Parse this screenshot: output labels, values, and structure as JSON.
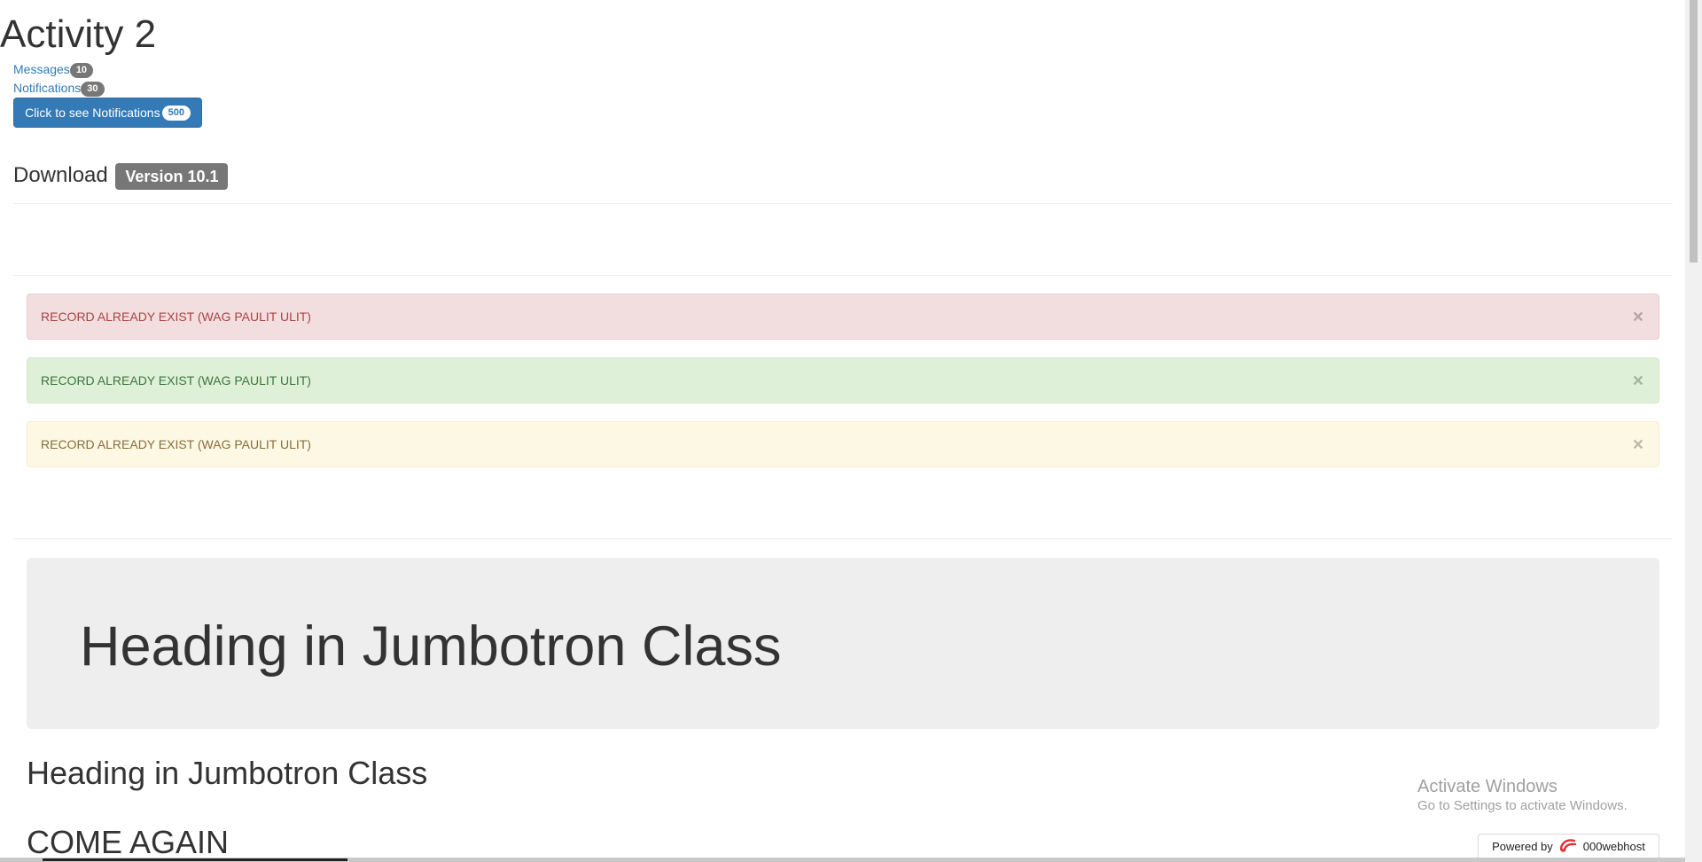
{
  "page": {
    "title": "Activity 2"
  },
  "links": {
    "messages": {
      "label": "Messages",
      "count": "10"
    },
    "notifications": {
      "label": "Notifications",
      "count": "30"
    }
  },
  "notify_button": {
    "label": "Click to see Notifications",
    "count": "500"
  },
  "download": {
    "label": "Download",
    "version": "Version 10.1"
  },
  "alerts": [
    {
      "type": "danger",
      "text": "RECORD ALREADY EXIST (WAG PAULIT ULIT)",
      "close": "×"
    },
    {
      "type": "success",
      "text": "RECORD ALREADY EXIST (WAG PAULIT ULIT)",
      "close": "×"
    },
    {
      "type": "warning",
      "text": "RECORD ALREADY EXIST (WAG PAULIT ULIT)",
      "close": "×"
    }
  ],
  "jumbotron": {
    "heading": "Heading in Jumbotron Class"
  },
  "subheading": "Heading in Jumbotron Class",
  "come_again": "COME AGAIN",
  "watermark": {
    "line1": "Activate Windows",
    "line2": "Go to Settings to activate Windows."
  },
  "powered_by": {
    "prefix": "Powered by",
    "brand": "000webhost",
    "icon": "000webhost-logo-icon"
  },
  "colors": {
    "primary": "#337ab7",
    "badge": "#777777",
    "danger_bg": "#f2dede",
    "success_bg": "#dff0d8",
    "warning_bg": "#fcf8e3",
    "jumbotron_bg": "#eeeeee"
  }
}
